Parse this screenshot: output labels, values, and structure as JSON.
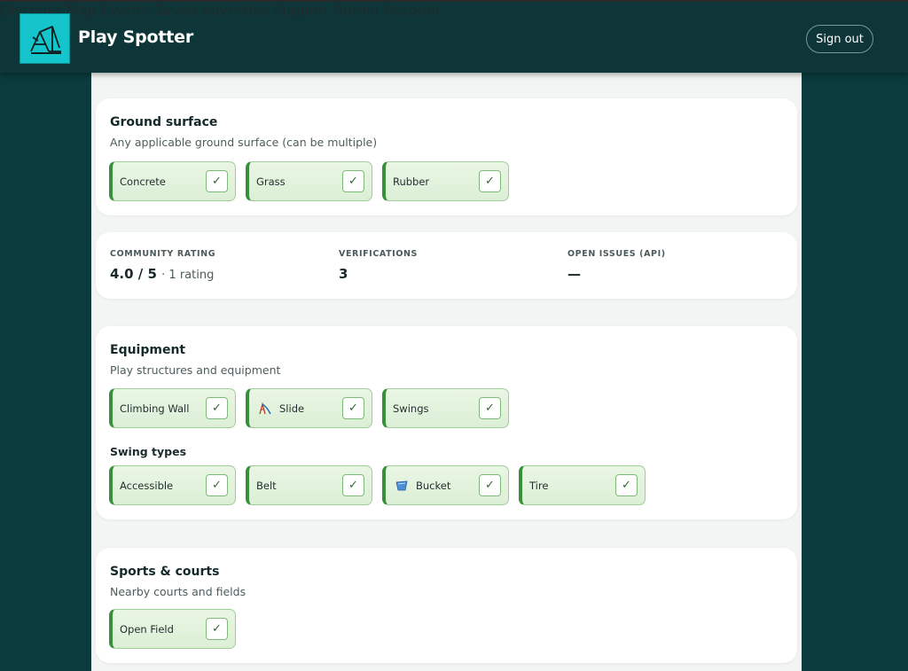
{
  "header": {
    "brand": "Play Spotter",
    "nav": [
      "Discover",
      "Map",
      "Events",
      "Saved",
      "Advertise",
      "Support",
      "Admin",
      "Account"
    ],
    "signout_label": "Sign out"
  },
  "ground": {
    "title": "Ground surface",
    "subtitle": "Any applicable ground surface (can be multiple)",
    "chips": [
      {
        "label": "Concrete",
        "check": "✓"
      },
      {
        "label": "Grass",
        "check": "✓"
      },
      {
        "label": "Rubber",
        "check": "✓"
      }
    ]
  },
  "stats": {
    "rating_label": "COMMUNITY RATING",
    "rating_value": "4.0 / 5",
    "rating_extra": "· 1 rating",
    "verifications_label": "VERIFICATIONS",
    "verifications_value": "3",
    "issues_label": "OPEN ISSUES (API)",
    "issues_value": "—"
  },
  "equipment": {
    "title": "Equipment",
    "subtitle": "Play structures and equipment",
    "chips": [
      {
        "label": "Climbing Wall",
        "check": "✓"
      },
      {
        "label": "Slide",
        "check": "✓",
        "icon": "slide-icon"
      },
      {
        "label": "Swings",
        "check": "✓"
      }
    ],
    "swing_types_title": "Swing types",
    "swing_chips": [
      {
        "label": "Accessible",
        "check": "✓"
      },
      {
        "label": "Belt",
        "check": "✓"
      },
      {
        "label": "Bucket",
        "check": "✓",
        "icon": "bucket-icon"
      },
      {
        "label": "Tire",
        "check": "✓"
      }
    ]
  },
  "sports": {
    "title": "Sports & courts",
    "subtitle": "Nearby courts and fields",
    "chips": [
      {
        "label": "Open Field",
        "check": "✓"
      }
    ]
  }
}
